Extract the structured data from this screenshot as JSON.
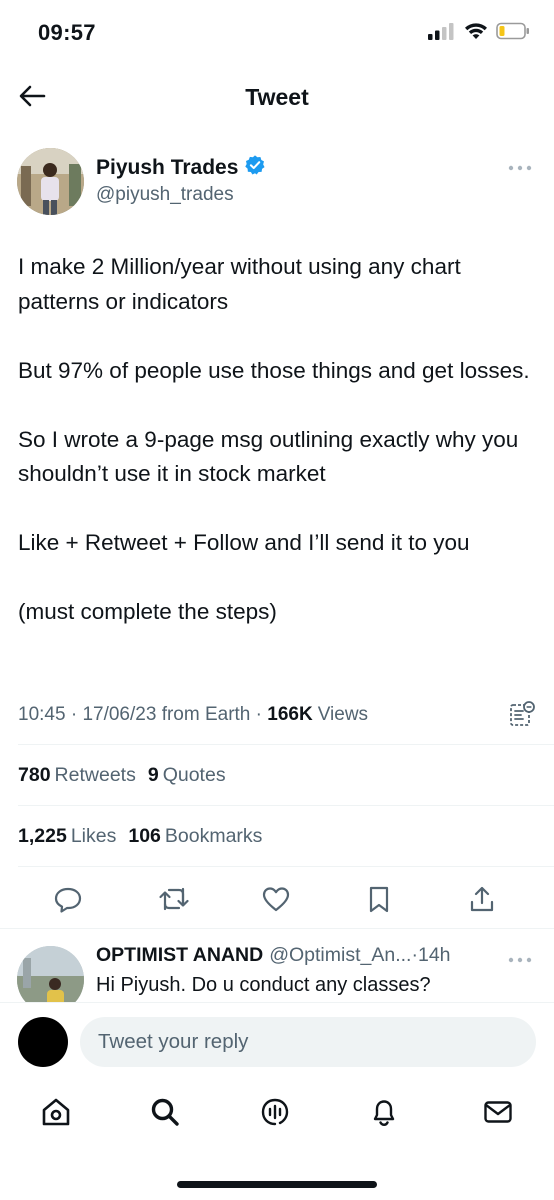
{
  "status_bar": {
    "time": "09:57",
    "icons": [
      "cellular-signal-icon",
      "wifi-icon",
      "battery-icon"
    ]
  },
  "header": {
    "title": "Tweet",
    "back_icon": "back-arrow-icon"
  },
  "author": {
    "name": "Piyush Trades",
    "handle": "@piyush_trades",
    "verified": true,
    "verified_color": "#1d9bf0"
  },
  "tweet": {
    "paragraphs": [
      "I make 2 Million/year without using any chart patterns or indicators",
      "But 97% of people use those things and get losses.",
      "So I wrote a 9-page msg outlining exactly why you shouldn’t use it in stock market",
      "Like + Retweet + Follow and I’ll send it to you",
      "(must complete the steps)"
    ]
  },
  "meta": {
    "time": "10:45",
    "date": "17/06/23",
    "source": "from Earth",
    "views_count": "166K",
    "views_label": "Views"
  },
  "stats": {
    "retweets_count": "780",
    "retweets_label": "Retweets",
    "quotes_count": "9",
    "quotes_label": "Quotes",
    "likes_count": "1,225",
    "likes_label": "Likes",
    "bookmarks_count": "106",
    "bookmarks_label": "Bookmarks"
  },
  "actions": [
    "reply-icon",
    "retweet-icon",
    "like-icon",
    "bookmark-icon",
    "share-icon"
  ],
  "reply": {
    "name": "OPTIMIST ANAND",
    "handle": "@Optimist_An...",
    "time": "14h",
    "text": "Hi Piyush. Do u conduct any classes?"
  },
  "reply_bar": {
    "placeholder": "Tweet your reply"
  },
  "tab_bar": [
    "home-icon",
    "search-icon",
    "spaces-icon",
    "notifications-icon",
    "messages-icon"
  ],
  "colors": {
    "text": "#0f1419",
    "secondary": "#536471",
    "divider": "#eff3f4",
    "accent": "#1d9bf0"
  }
}
